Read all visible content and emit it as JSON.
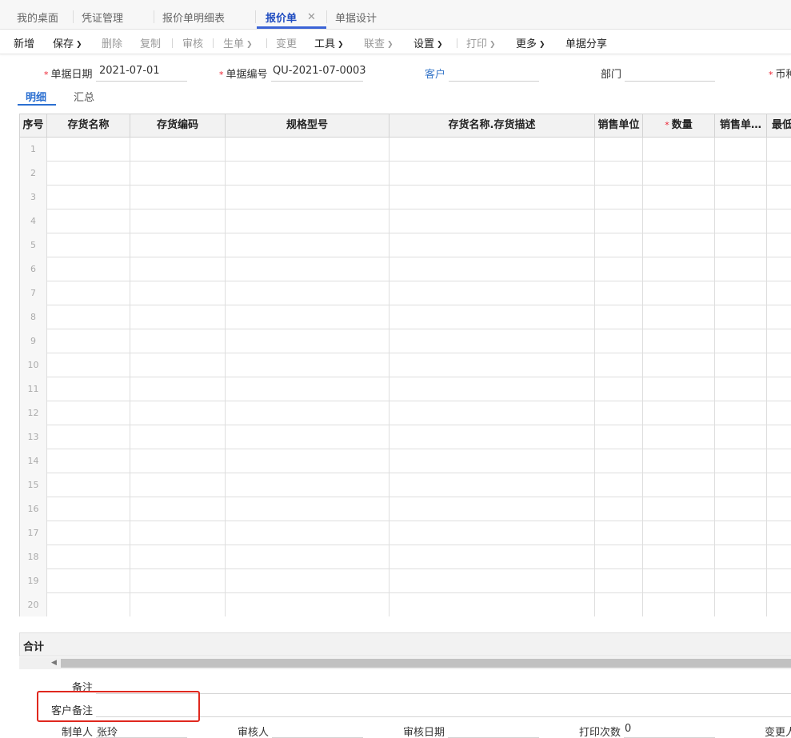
{
  "tabs": [
    {
      "label": "我的桌面"
    },
    {
      "label": "凭证管理"
    },
    {
      "label": "报价单明细表"
    },
    {
      "label": "报价单"
    },
    {
      "label": "单据设计"
    }
  ],
  "toolbar": {
    "new": "新增",
    "save": "保存",
    "delete": "删除",
    "copy": "复制",
    "audit": "审核",
    "generate": "生单",
    "change": "变更",
    "tools": "工具",
    "query": "联查",
    "settings": "设置",
    "print": "打印",
    "more": "更多",
    "share": "单据分享"
  },
  "form": {
    "date_label": "单据日期",
    "date_value": "2021-07-01",
    "code_label": "单据编号",
    "code_value": "QU-2021-07-0003",
    "customer_label": "客户",
    "dept_label": "部门",
    "currency_label": "币种"
  },
  "subtabs": [
    "明细",
    "汇总"
  ],
  "grid": {
    "columns": [
      "序号",
      "存货名称",
      "存货编码",
      "规格型号",
      "存货名称.存货描述",
      "销售单位",
      "数量",
      "销售单…",
      "最低"
    ],
    "rows": [
      "1",
      "2",
      "3",
      "4",
      "5",
      "6",
      "7",
      "8",
      "9",
      "10",
      "11",
      "12",
      "13",
      "14",
      "15",
      "16",
      "17",
      "18",
      "19",
      "20"
    ]
  },
  "totals": {
    "label": "合计"
  },
  "footer": {
    "remark_label": "备注",
    "customer_remark_label": "客户备注",
    "maker_label": "制单人",
    "maker_value": "张玲",
    "auditor_label": "审核人",
    "audit_date_label": "审核日期",
    "print_count_label": "打印次数",
    "print_count_value": "0",
    "changer_label": "变更人"
  },
  "colors": {
    "accent": "#3a63d6",
    "highlight_box": "#e0281e"
  }
}
